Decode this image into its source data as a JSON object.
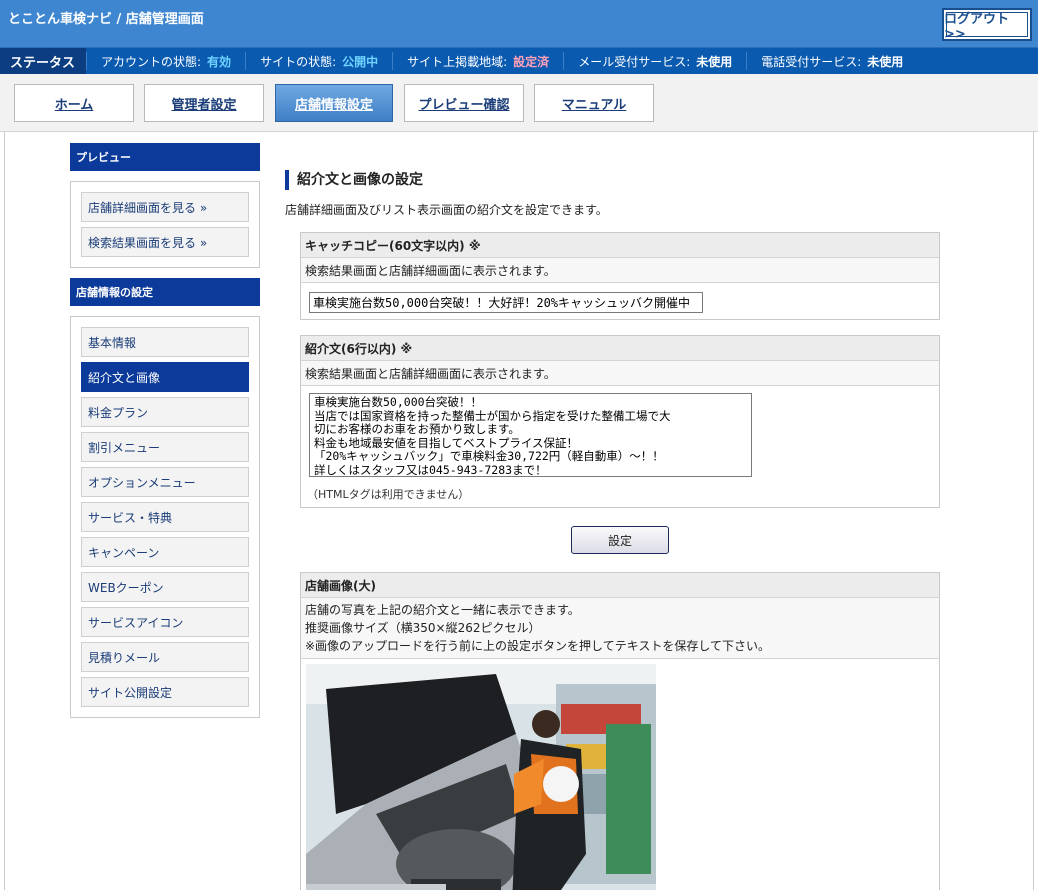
{
  "header": {
    "app_title": "とことん車検ナビ / 店舗管理画面",
    "logout_label": "ログアウト >>"
  },
  "status": {
    "label": "ステータス",
    "items": [
      {
        "label": "アカウントの状態:",
        "value": "有効"
      },
      {
        "label": "サイトの状態:",
        "value": "公開中"
      },
      {
        "label": "サイト上掲載地域:",
        "value": "設定済"
      },
      {
        "label": "メール受付サービス:",
        "value": "未使用"
      },
      {
        "label": "電話受付サービス:",
        "value": "未使用"
      }
    ]
  },
  "nav": {
    "tabs": [
      {
        "label": "ホーム"
      },
      {
        "label": "管理者設定"
      },
      {
        "label": "店舗情報設定"
      },
      {
        "label": "プレビュー確認"
      },
      {
        "label": "マニュアル"
      }
    ]
  },
  "sidebar": {
    "preview_heading": "プレビュー",
    "preview_links": [
      "店舗詳細画面を見る »",
      "検索結果画面を見る »"
    ],
    "settings_heading": "店舗情報の設定",
    "settings_items": [
      "基本情報",
      "紹介文と画像",
      "料金プラン",
      "割引メニュー",
      "オプションメニュー",
      "サービス・特典",
      "キャンペーン",
      "WEBクーポン",
      "サービスアイコン",
      "見積りメール",
      "サイト公開設定"
    ]
  },
  "main": {
    "title": "紹介文と画像の設定",
    "description": "店舗詳細画面及びリスト表示画面の紹介文を設定できます。",
    "catch": {
      "heading": "キャッチコピー(60文字以内) ※",
      "note": "検索結果画面と店舗詳細画面に表示されます。",
      "value": "車検実施台数50,000台突破！！大好評！20%キャッシュッバク開催中"
    },
    "intro": {
      "heading": "紹介文(6行以内) ※",
      "note": "検索結果画面と店舗詳細画面に表示されます。",
      "value": "車検実施台数50,000台突破！！\n当店では国家資格を持った整備士が国から指定を受けた整備工場で大\n切にお客様のお車をお預かり致します。\n料金も地域最安値を目指してベストプライス保証！\n「20%キャッシュバック」で車検料金30,722円（軽自動車）～！！\n詳しくはスタッフ又は045-943-7283まで！",
      "html_note": "（HTMLタグは利用できません）"
    },
    "submit_label": "設定",
    "image": {
      "heading": "店舗画像(大)",
      "lines": [
        "店舗の写真を上記の紹介文と一緒に表示できます。",
        "推奨画像サイズ（横350×縦262ピクセル）",
        "※画像のアップロードを行う前に上の設定ボタンを押してテキストを保存して下さい。"
      ]
    }
  },
  "colors": {
    "header_blue": "#3e86d0",
    "status_blue": "#0a5ab0",
    "navy": "#0b3a9a",
    "status_ok": "#6fd3ff",
    "status_set": "#ff9fb8"
  }
}
